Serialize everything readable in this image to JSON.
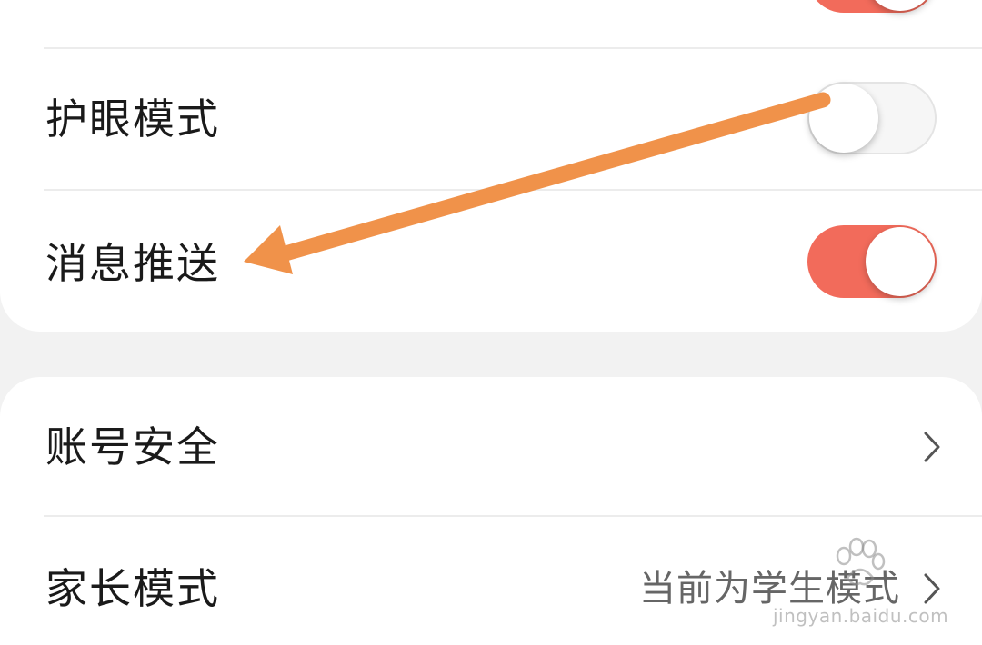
{
  "settings_group_1": {
    "items": [
      {
        "label": "护眼模式",
        "toggle": "off"
      },
      {
        "label": "消息推送",
        "toggle": "on"
      }
    ]
  },
  "settings_group_2": {
    "items": [
      {
        "label": "账号安全",
        "value": ""
      },
      {
        "label": "家长模式",
        "value": "当前为学生模式"
      }
    ]
  },
  "colors": {
    "toggle_on": "#f26b5b",
    "arrow": "#f0924a"
  },
  "watermark": {
    "url": "jingyan.baidu.com"
  }
}
